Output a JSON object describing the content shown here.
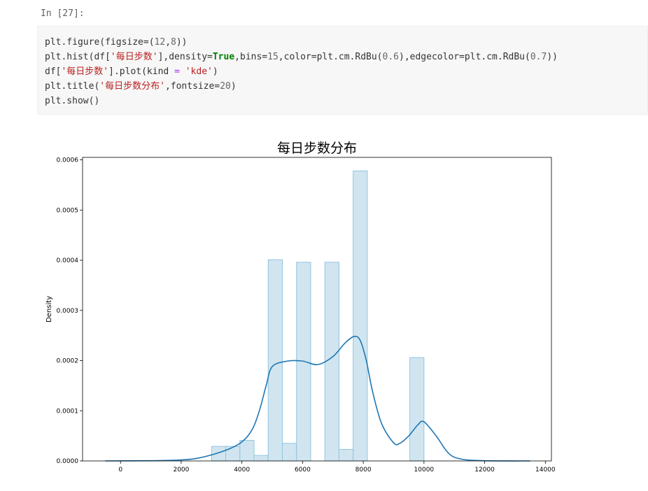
{
  "cell": {
    "prompt": "In [27]:",
    "code_lines": [
      [
        {
          "t": "plt.figure(figsize=(",
          "c": ""
        },
        {
          "t": "12",
          "c": "num"
        },
        {
          "t": ",",
          "c": ""
        },
        {
          "t": "8",
          "c": "num"
        },
        {
          "t": "))",
          "c": ""
        }
      ],
      [
        {
          "t": "plt.hist(df[",
          "c": ""
        },
        {
          "t": "'每日步数'",
          "c": "str"
        },
        {
          "t": "],density=",
          "c": ""
        },
        {
          "t": "True",
          "c": "kw"
        },
        {
          "t": ",bins=",
          "c": ""
        },
        {
          "t": "15",
          "c": "num"
        },
        {
          "t": ",color=plt.cm.RdBu(",
          "c": ""
        },
        {
          "t": "0.6",
          "c": "num"
        },
        {
          "t": "),edgecolor=plt.cm.RdBu(",
          "c": ""
        },
        {
          "t": "0.7",
          "c": "num"
        },
        {
          "t": "))",
          "c": ""
        }
      ],
      [
        {
          "t": "df[",
          "c": ""
        },
        {
          "t": "'每日步数'",
          "c": "str"
        },
        {
          "t": "].plot(kind ",
          "c": ""
        },
        {
          "t": "=",
          "c": "op"
        },
        {
          "t": " ",
          "c": ""
        },
        {
          "t": "'kde'",
          "c": "str"
        },
        {
          "t": ")",
          "c": ""
        }
      ],
      [
        {
          "t": "plt.title(",
          "c": ""
        },
        {
          "t": "'每日步数分布'",
          "c": "str"
        },
        {
          "t": ",fontsize=",
          "c": ""
        },
        {
          "t": "20",
          "c": "num"
        },
        {
          "t": ")",
          "c": ""
        }
      ],
      [
        {
          "t": "plt.show()",
          "c": ""
        }
      ]
    ]
  },
  "chart_data": {
    "type": "bar",
    "title": "每日步数分布",
    "xlabel": "",
    "ylabel": "Density",
    "xlim": [
      -1250,
      14200
    ],
    "ylim": [
      0,
      0.000605
    ],
    "xticks": [
      0,
      2000,
      4000,
      6000,
      8000,
      10000,
      12000,
      14000
    ],
    "yticks": [
      0.0,
      0.0001,
      0.0002,
      0.0003,
      0.0004,
      0.0005,
      0.0006
    ],
    "ytick_labels": [
      "0.0000",
      "0.0001",
      "0.0002",
      "0.0003",
      "0.0004",
      "0.0005",
      "0.0006"
    ],
    "histogram": {
      "bin_edges": [
        3000,
        3466.7,
        3933.3,
        4400,
        4866.7,
        5333.3,
        5800,
        6266.7,
        6733.3,
        7200,
        7666.7,
        8133.3,
        8600,
        9066.7,
        9533.3,
        10000
      ],
      "density": [
        2.9e-05,
        2.9e-05,
        4.1e-05,
        1.1e-05,
        0.000401,
        3.5e-05,
        0.000396,
        0,
        0.000396,
        2.3e-05,
        0.000578,
        0,
        0,
        0,
        0.000206
      ],
      "fill_color": "#d1e5f0",
      "edge_color": "#92c5de"
    },
    "kde": {
      "x": [
        -500,
        1000,
        2000,
        2500,
        3000,
        3500,
        3800,
        4000,
        4200,
        4400,
        4600,
        4800,
        5000,
        5500,
        6000,
        6500,
        7000,
        7400,
        7700,
        7900,
        8100,
        8300,
        8600,
        9000,
        9200,
        9500,
        9800,
        10000,
        10400,
        10800,
        11200,
        12000,
        13500
      ],
      "y": [
        0,
        5e-07,
        2e-06,
        5e-06,
        1.2e-05,
        2.2e-05,
        3e-05,
        3.8e-05,
        5e-05,
        7e-05,
        0.000105,
        0.00015,
        0.000188,
        0.000199,
        0.000199,
        0.000192,
        0.000208,
        0.000235,
        0.000248,
        0.00024,
        0.0002,
        0.00014,
        7.5e-05,
        3.6e-05,
        3.5e-05,
        5e-05,
        7.2e-05,
        7.8e-05,
        5e-05,
        1.6e-05,
        4e-06,
        4e-07,
        0
      ],
      "color": "#1f77b4"
    }
  }
}
